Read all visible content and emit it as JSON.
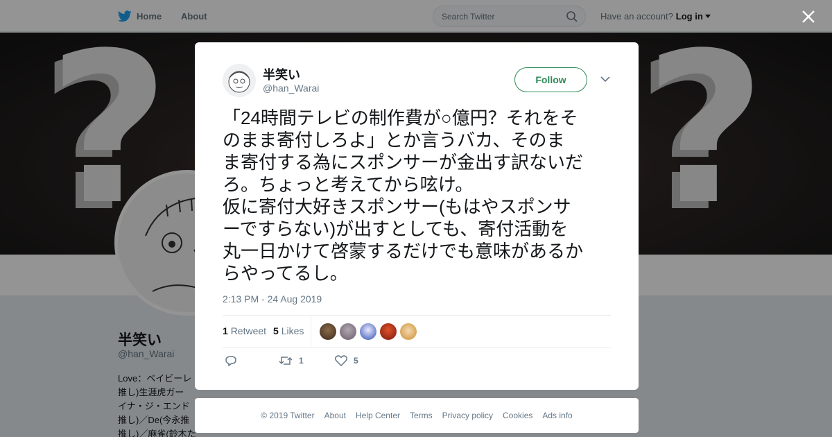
{
  "nav": {
    "home_label": "Home",
    "about_label": "About",
    "search_placeholder": "Search Twitter",
    "have_account": "Have an account?",
    "login_label": "Log in"
  },
  "profile": {
    "name": "半笑い",
    "handle": "@han_Warai",
    "bio_lines": [
      "Love：ベイビーレ",
      "推し)生涯虎ガー",
      "イナ・ジ・エンド",
      "推し)／De(今永推",
      "推し)／麻雀(鈴木た"
    ]
  },
  "tweet": {
    "author_name": "半笑い",
    "author_handle": "@han_Warai",
    "follow_label": "Follow",
    "text_lines": [
      "「24時間テレビの制作費が○億円？それをそ",
      "のまま寄付しろよ」とか言うバカ、そのま",
      "ま寄付する為にスポンサーが金出す訳ないだ",
      "ろ。ちょっと考えてから呟け。",
      "仮に寄付大好きスポンサー(もはやスポンサ",
      "ーですらない)が出すとしても、寄付活動を",
      "丸一日かけて啓蒙するだけでも意味があるか",
      "らやってるし。"
    ],
    "timestamp": "2:13 PM - 24 Aug 2019",
    "retweet_count": "1",
    "retweet_label": "Retweet",
    "like_count": "5",
    "like_label": "Likes",
    "action_retweet_count": "1",
    "action_like_count": "5"
  },
  "footer": {
    "copyright": "© 2019 Twitter",
    "links": [
      "About",
      "Help Center",
      "Terms",
      "Privacy policy",
      "Cookies",
      "Ads info"
    ]
  },
  "colors": {
    "twitter_blue": "#1da1f2",
    "follow_border": "#2e8b57",
    "muted_text": "#657786"
  }
}
